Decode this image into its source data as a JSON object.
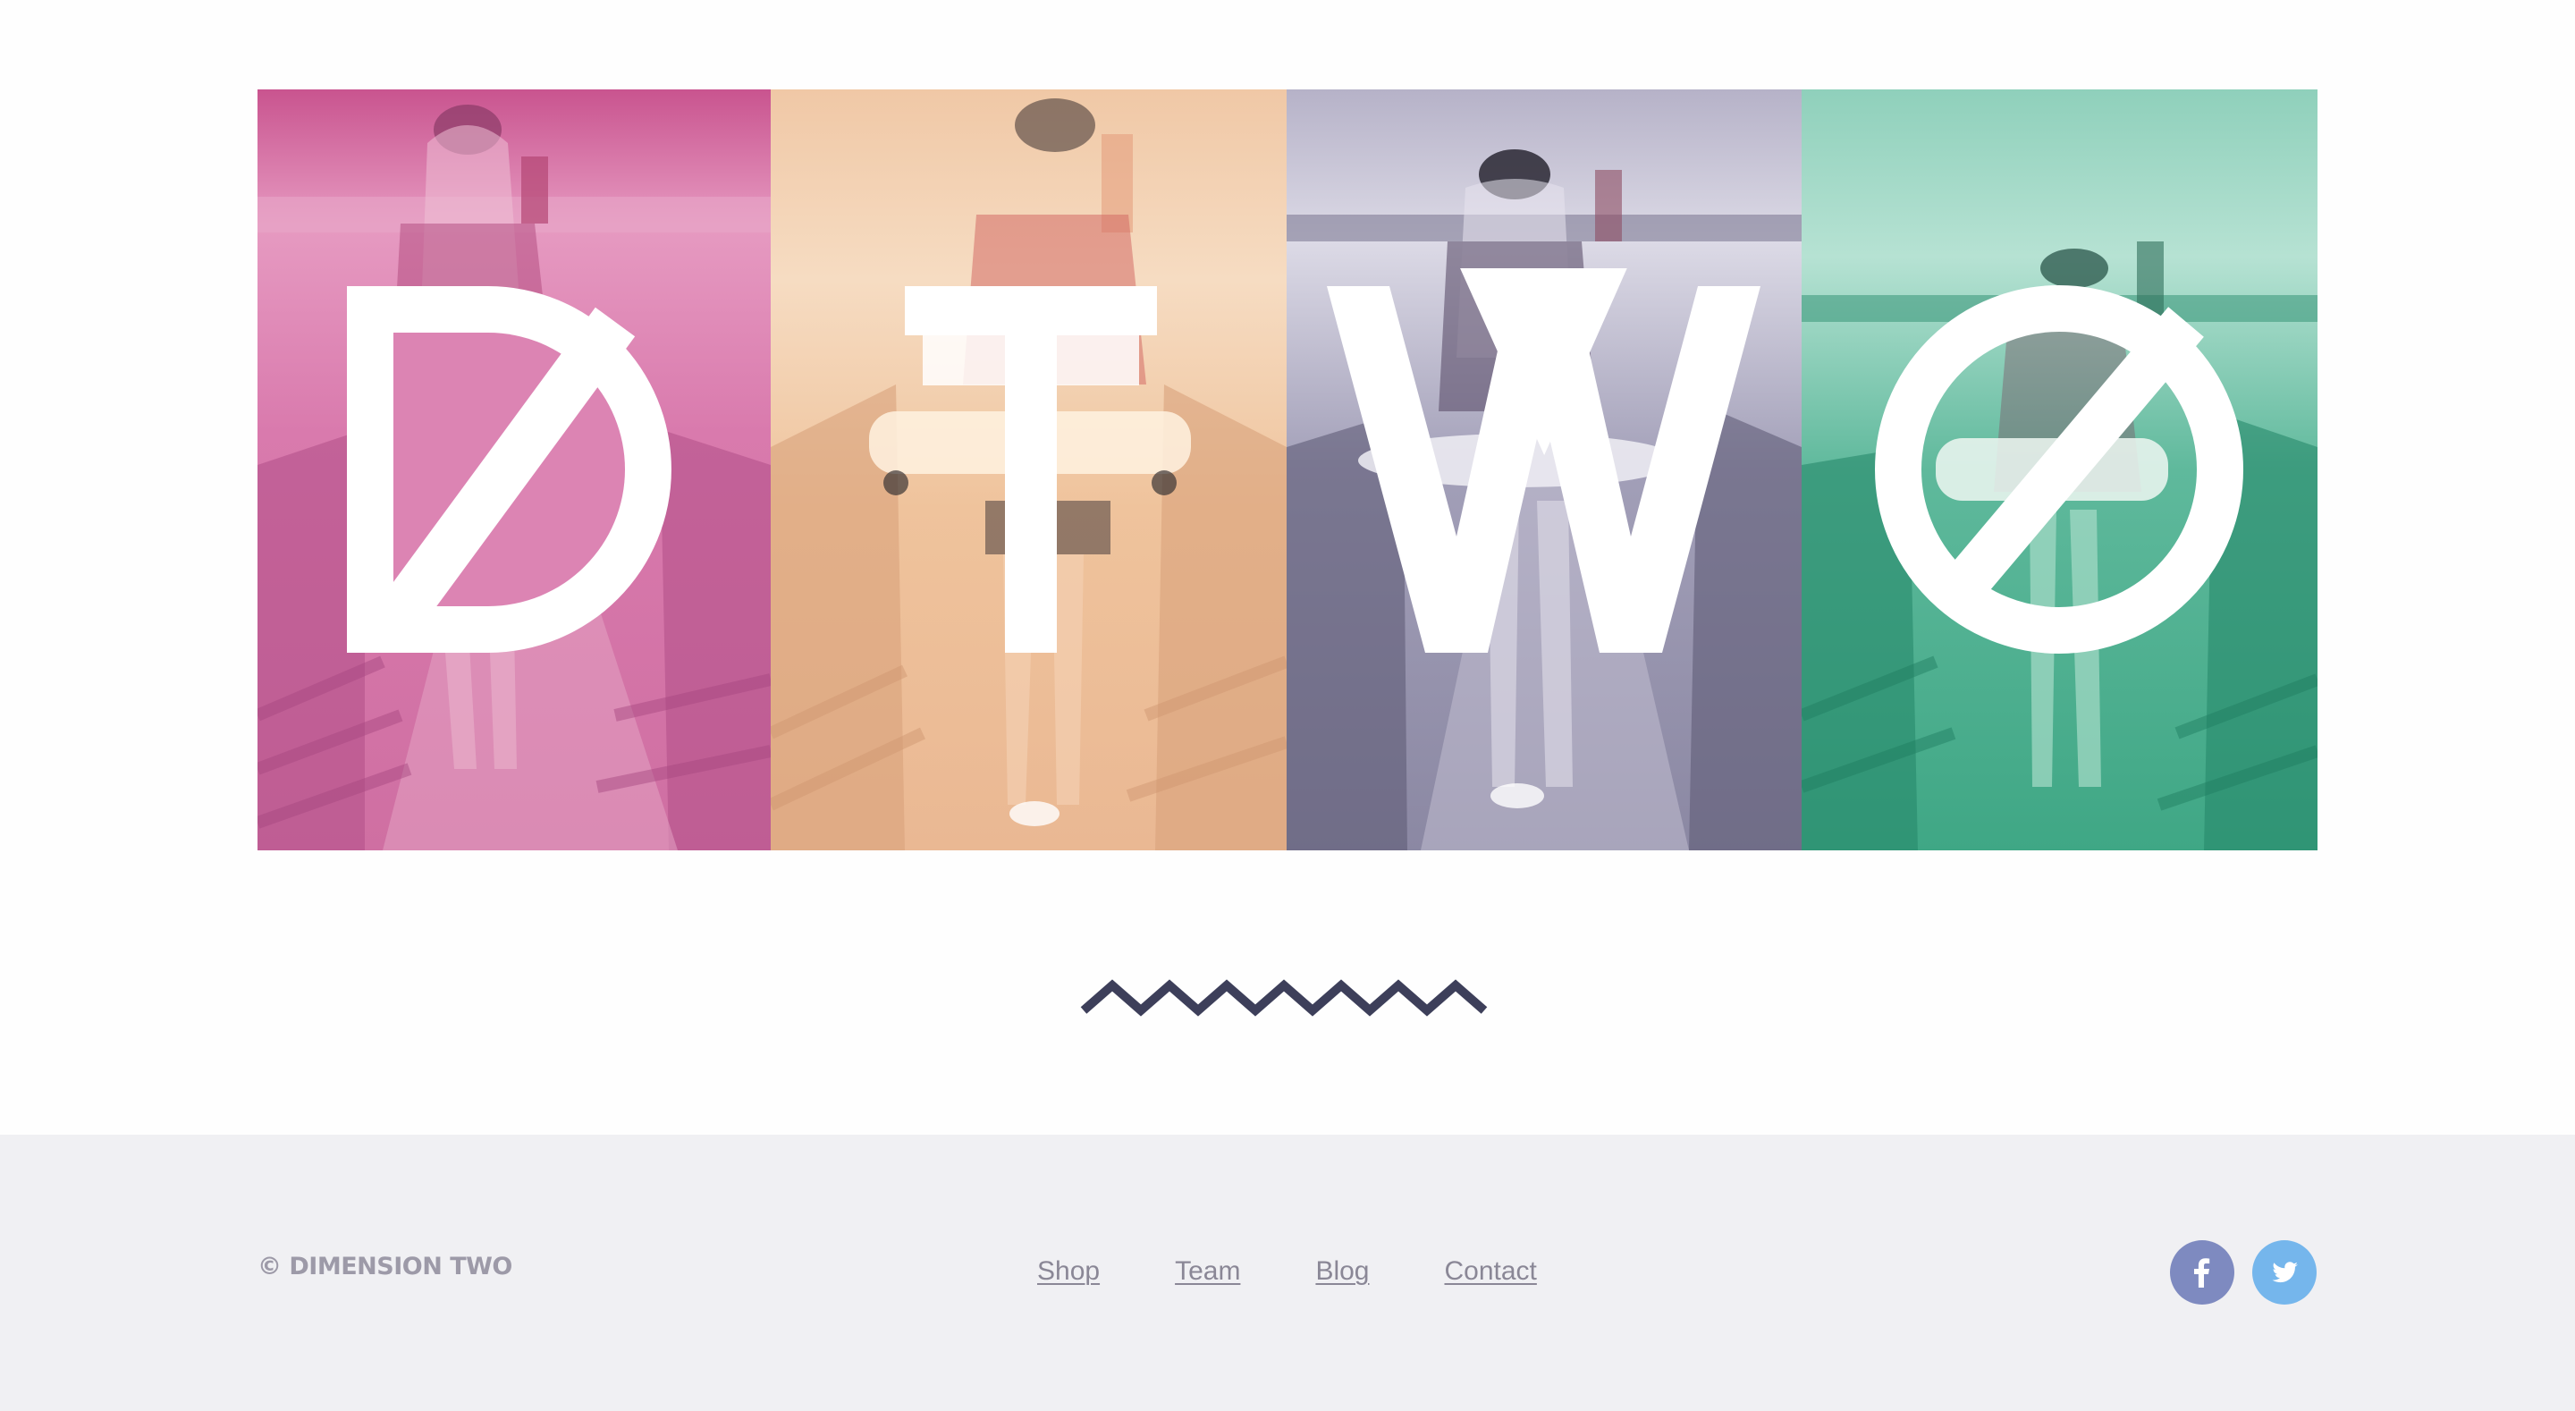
{
  "hero": {
    "letters": [
      "D",
      "T",
      "W",
      "O"
    ],
    "panel_colors": [
      "#d56aa6",
      "#f2c9a0",
      "#8c86a8",
      "#4cb193"
    ]
  },
  "footer": {
    "brand": "© DIMENSION TWO",
    "nav": [
      {
        "label": "Shop"
      },
      {
        "label": "Team"
      },
      {
        "label": "Blog"
      },
      {
        "label": "Contact"
      }
    ],
    "social": {
      "facebook_icon": "facebook-icon",
      "twitter_icon": "twitter-icon"
    }
  },
  "colors": {
    "zigzag": "#3d3f5a",
    "footer_bg": "#f0f0f3",
    "facebook": "#7e8ac0",
    "twitter": "#75b6ec"
  }
}
